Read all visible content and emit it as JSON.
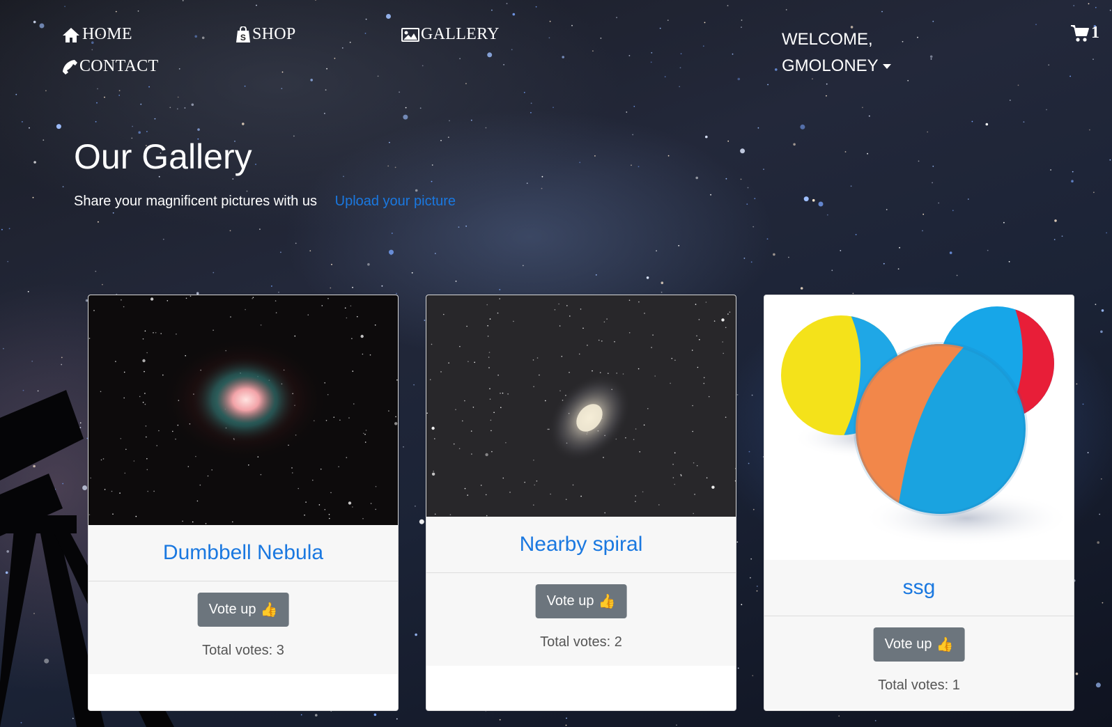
{
  "nav": {
    "home": "HOME",
    "shop": "SHOP",
    "gallery": "GALLERY",
    "contact": "CONTACT",
    "welcome_line1": "WELCOME,",
    "welcome_line2": "GMOLONEY",
    "cart_count": "1"
  },
  "header": {
    "title": "Our Gallery",
    "subtitle": "Share your magnificent pictures with us",
    "upload_link": "Upload your picture"
  },
  "gallery": [
    {
      "title": "Dumbbell Nebula",
      "vote_label": "Vote up",
      "vote_icon": "👍",
      "total_votes": "Total votes: 3",
      "image": "nebula-image"
    },
    {
      "title": "Nearby spiral",
      "vote_label": "Vote up",
      "vote_icon": "👍",
      "total_votes": "Total votes: 2",
      "image": "spiral-galaxy-image"
    },
    {
      "title": "ssg",
      "vote_label": "Vote up",
      "vote_icon": "👍",
      "total_votes": "Total votes: 1",
      "image": "colorful-balls-image"
    }
  ],
  "colors": {
    "link": "#1a78e0",
    "button": "#6c757d",
    "card_section": "#f7f7f7"
  },
  "icons": [
    "home-icon",
    "shop-icon",
    "gallery-icon",
    "phone-icon",
    "cart-icon",
    "thumbs-up-icon",
    "caret-down-icon"
  ]
}
